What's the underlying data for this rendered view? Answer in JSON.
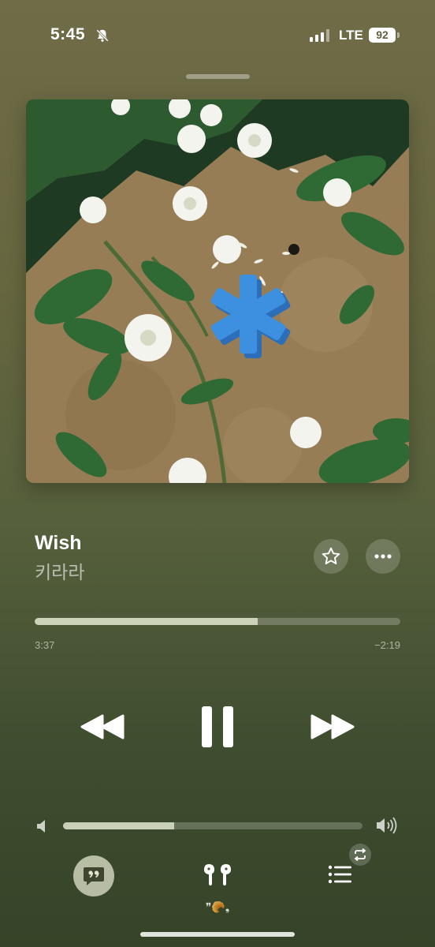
{
  "status_bar": {
    "time": "5:45",
    "network": "LTE",
    "battery": "92",
    "signal_bars_active": 3,
    "icons": [
      "silent-bell-icon",
      "signal-icon",
      "battery-icon"
    ]
  },
  "now_playing": {
    "title": "Wish",
    "artist": "키라라",
    "artwork": "flowers-and-blue-asterisk-artwork",
    "progress_fraction": 0.61,
    "elapsed": "3:37",
    "remaining": "−2:19",
    "volume_fraction": 0.37
  },
  "controls": {
    "favorite": "star-icon",
    "more": "ellipsis-icon",
    "previous": "rewind-icon",
    "play_pause": "pause-icon",
    "next": "fast-forward-icon"
  },
  "bottom_bar": {
    "lyrics": "lyrics-quote-icon",
    "airplay_device": "airpods-icon",
    "airplay_label": "❞🥐❟",
    "queue": "list-icon",
    "repeat": "repeat-icon"
  },
  "colors": {
    "background_top": "#6f6c47",
    "background_bottom": "#354328",
    "artwork_accent": "#3d8fe0"
  }
}
